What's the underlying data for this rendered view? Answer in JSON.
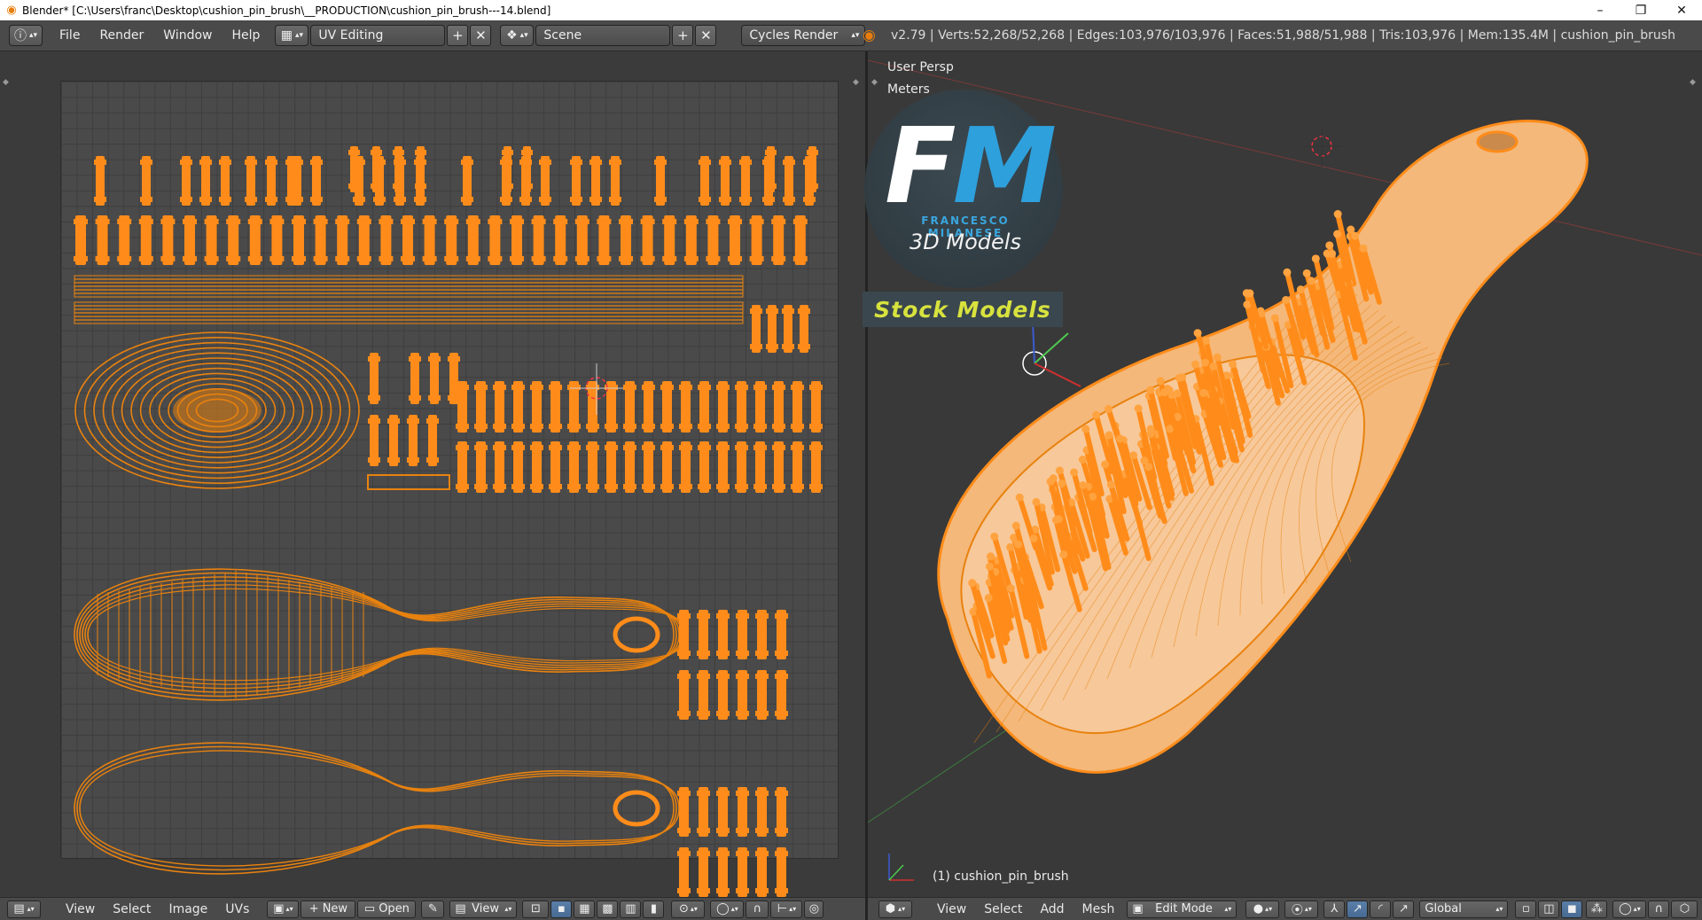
{
  "window": {
    "title": "Blender* [C:\\Users\\franc\\Desktop\\cushion_pin_brush\\__PRODUCTION\\cushion_pin_brush---14.blend]",
    "minimize": "–",
    "maximize": "❐",
    "close": "✕"
  },
  "topbar": {
    "info_icon": "ⓘ",
    "menus": [
      "File",
      "Render",
      "Window",
      "Help"
    ],
    "screen_layout": "UV Editing",
    "scene": "Scene",
    "render_engine": "Cycles Render",
    "stats": "v2.79 | Verts:52,268/52,268 | Edges:103,976/103,976 | Faces:51,988/51,988 | Tris:103,976 | Mem:135.4M | cushion_pin_brush"
  },
  "viewport": {
    "view_label": "User Persp",
    "units_label": "Meters",
    "object_label": "(1) cushion_pin_brush"
  },
  "watermark": {
    "letters_f": "F",
    "letters_m": "M",
    "name": "FRANCESCO MILANESE",
    "subtitle": "3D Models",
    "stock": "Stock Models"
  },
  "uv_header": {
    "menus": [
      "View",
      "Select",
      "Image",
      "UVs"
    ],
    "new_label": "New",
    "open_label": "Open",
    "view_select": "View"
  },
  "view3d_header": {
    "menus": [
      "View",
      "Select",
      "Add",
      "Mesh"
    ],
    "mode": "Edit Mode",
    "orientation": "Global"
  },
  "colors": {
    "accent_orange": "#ff8c1a",
    "wire_orange": "#e8820f",
    "brush_face": "#f4b87a",
    "fm_blue": "#3aa6de",
    "stock_yellow": "#d7e23e"
  }
}
